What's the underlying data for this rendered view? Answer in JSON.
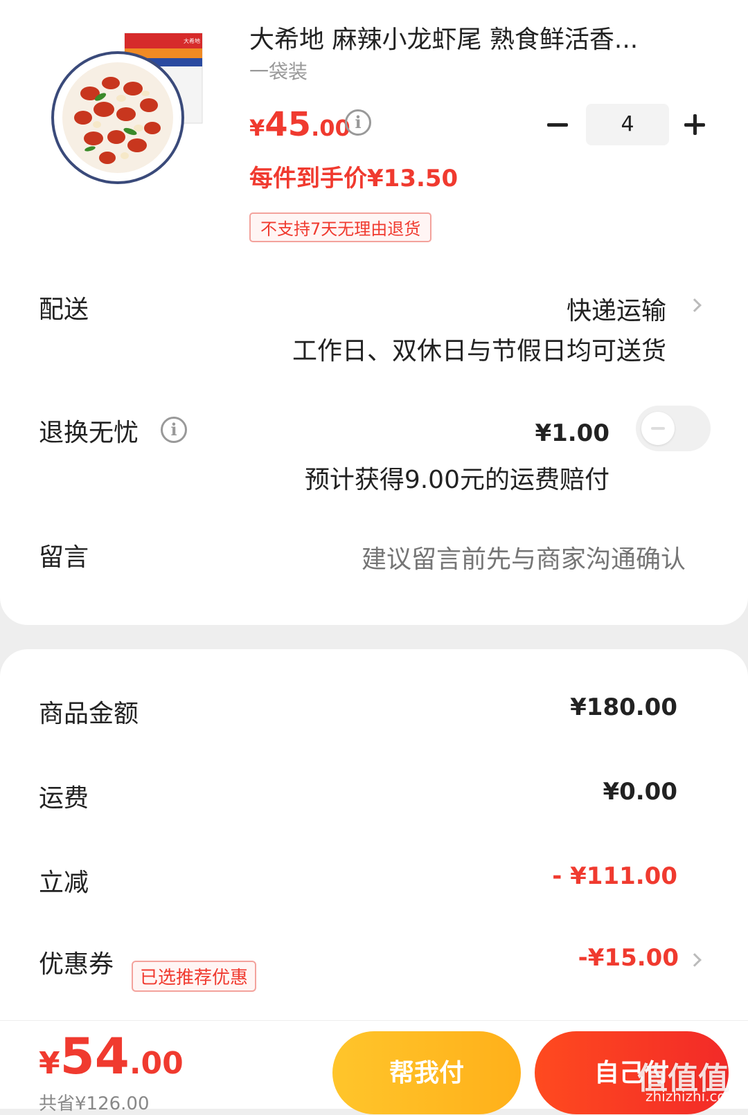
{
  "product": {
    "title": "大希地 麻辣小龙虾尾 熟食鲜活香...",
    "spec": "一袋装",
    "price_currency": "¥",
    "price_int": "45",
    "price_dec": ".00",
    "info_symbol": "i",
    "unit_price": "每件到手价¥13.50",
    "tag": "不支持7天无理由退货",
    "package_brand": "大希地",
    "quantity": "4"
  },
  "delivery": {
    "label": "配送",
    "value": "快递运输",
    "sub": "工作日、双休日与节假日均可送货"
  },
  "return_insurance": {
    "label": "退换无忧",
    "info_symbol": "i",
    "price": "¥1.00",
    "sub": "预计获得9.00元的运费赔付",
    "enabled": false
  },
  "message": {
    "label": "留言",
    "placeholder": "建议留言前先与商家沟通确认"
  },
  "summary": {
    "goods_label": "商品金额",
    "goods_value": "¥180.00",
    "shipping_label": "运费",
    "shipping_value": "¥0.00",
    "discount_label": "立减",
    "discount_value": "- ¥111.00",
    "coupon_label": "优惠券",
    "coupon_tag": "已选推荐优惠",
    "coupon_value": "-¥15.00"
  },
  "footer": {
    "total_currency": "¥",
    "total_int": "54",
    "total_dec": ".00",
    "saved": "共省¥126.00",
    "help_pay": "帮我付",
    "self_pay": "自己付",
    "watermark": "值值值",
    "watermark_url": "zhizhizhi.com"
  },
  "colors": {
    "accent_red": "#f03a2f",
    "accent_yellow": "#ffb01a"
  }
}
